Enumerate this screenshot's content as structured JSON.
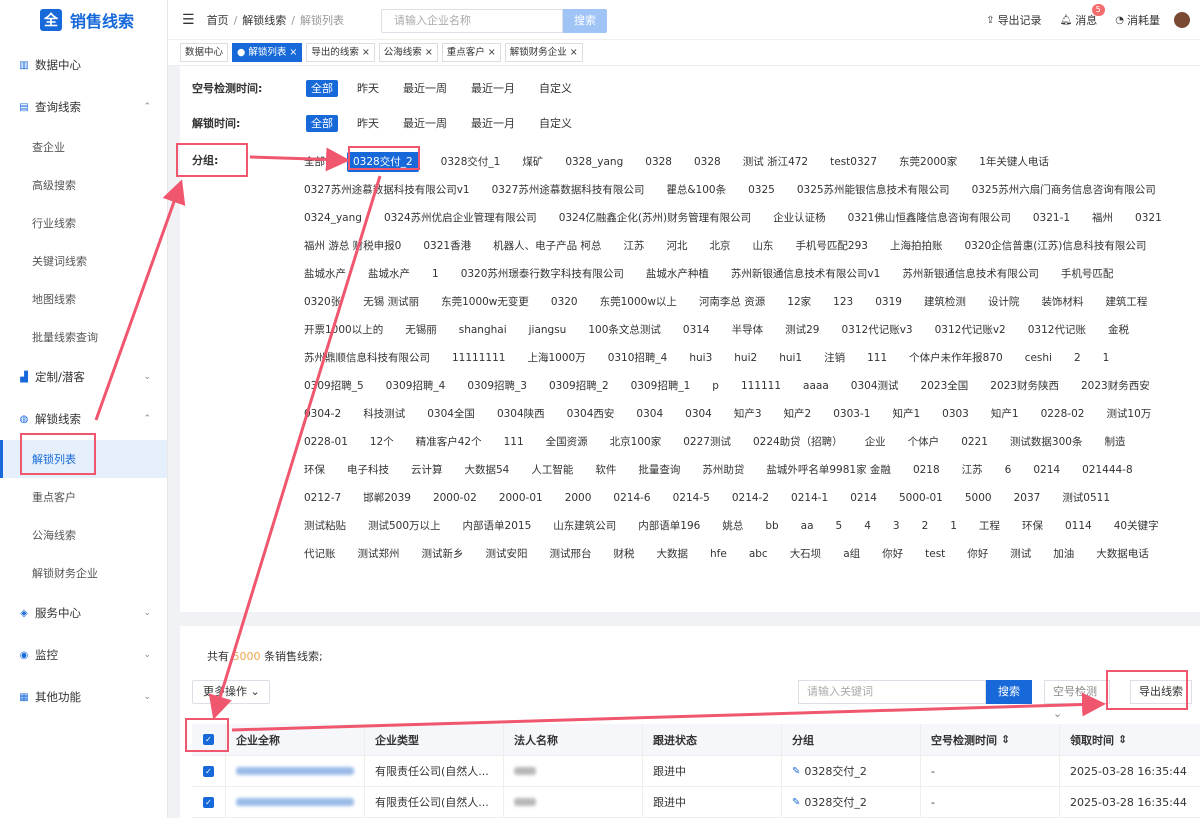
{
  "app": {
    "logo_char": "全",
    "title": "销售线索"
  },
  "sidebar": {
    "items": [
      {
        "type": "group",
        "label": "数据中心",
        "icon": "database-icon",
        "chev": ""
      },
      {
        "type": "group",
        "label": "查询线索",
        "icon": "query-icon",
        "chev": "⌃"
      },
      {
        "type": "sub",
        "label": "查企业"
      },
      {
        "type": "sub",
        "label": "高级搜索"
      },
      {
        "type": "sub",
        "label": "行业线索"
      },
      {
        "type": "sub",
        "label": "关键词线索"
      },
      {
        "type": "sub",
        "label": "地图线索"
      },
      {
        "type": "sub",
        "label": "批量线索查询"
      },
      {
        "type": "group",
        "label": "定制/潜客",
        "icon": "chart-icon",
        "chev": "⌄"
      },
      {
        "type": "group",
        "label": "解锁线索",
        "icon": "globe-icon",
        "chev": "⌃"
      },
      {
        "type": "sub",
        "label": "解锁列表",
        "active": true
      },
      {
        "type": "sub",
        "label": "重点客户"
      },
      {
        "type": "sub",
        "label": "公海线索"
      },
      {
        "type": "sub",
        "label": "解锁财务企业"
      },
      {
        "type": "group",
        "label": "服务中心",
        "icon": "cube-icon",
        "chev": "⌄"
      },
      {
        "type": "group",
        "label": "监控",
        "icon": "monitor-icon",
        "chev": "⌄"
      },
      {
        "type": "group",
        "label": "其他功能",
        "icon": "grid-icon",
        "chev": "⌄"
      }
    ]
  },
  "header": {
    "breadcrumb": [
      "首页",
      "解锁线索",
      "解锁列表"
    ],
    "search_placeholder": "请输入企业名称",
    "search_button": "搜索",
    "export_record": "导出记录",
    "message": "消息",
    "message_count": "5",
    "consumption": "消耗量"
  },
  "tabs": [
    {
      "label": "数据中心",
      "active": false,
      "closable": false
    },
    {
      "label": "解锁列表",
      "active": true,
      "closable": true
    },
    {
      "label": "导出的线索",
      "active": false,
      "closable": true
    },
    {
      "label": "公海线索",
      "active": false,
      "closable": true
    },
    {
      "label": "重点客户",
      "active": false,
      "closable": true
    },
    {
      "label": "解锁财务企业",
      "active": false,
      "closable": true
    }
  ],
  "filters": {
    "empty_check": {
      "label": "空号检测时间:",
      "options": [
        "全部",
        "昨天",
        "最近一周",
        "最近一月",
        "自定义"
      ],
      "selected": 0
    },
    "unlock_time": {
      "label": "解锁时间:",
      "options": [
        "全部",
        "昨天",
        "最近一周",
        "最近一月",
        "自定义"
      ],
      "selected": 0
    },
    "group": {
      "label": "分组:",
      "selected": 1,
      "tags": [
        "全部",
        "0328交付_2",
        "0328交付_1",
        "煤矿",
        "0328_yang",
        "0328",
        "0328",
        "测试 浙江472",
        "test0327",
        "东莞2000家",
        "1年关键人电话",
        "0327苏州途慕数据科技有限公司v1",
        "0327苏州途慕数据科技有限公司",
        "瞿总&100条",
        "0325",
        "0325苏州能银信息技术有限公司",
        "0325苏州六扇门商务信息咨询有限公司",
        "0324_yang",
        "0324苏州优启企业管理有限公司",
        "0324亿融鑫企化(苏州)财务管理有限公司",
        "企业认证杨",
        "0321佛山恒鑫隆信息咨询有限公司",
        "0321-1",
        "福州",
        "0321",
        "福州 游总 财税申报0",
        "0321香港",
        "机器人、电子产品 柯总",
        "江苏",
        "河北",
        "北京",
        "山东",
        "手机号匹配293",
        "上海拍拍账",
        "0320企信普惠(江苏)信息科技有限公司",
        "盐城水产",
        "盐城水产",
        "1",
        "0320苏州璟泰行数字科技有限公司",
        "盐城水产种植",
        "苏州新银通信息技术有限公司v1",
        "苏州新银通信息技术有限公司",
        "手机号匹配",
        "0320张",
        "无锡 测试丽",
        "东莞1000w无变更",
        "0320",
        "东莞1000w以上",
        "河南李总 资源",
        "12家",
        "123",
        "0319",
        "建筑检测",
        "设计院",
        "装饰材料",
        "建筑工程",
        "开票1000以上的",
        "无锡丽",
        "shanghai",
        "jiangsu",
        "100条文总测试",
        "0314",
        "半导体",
        "测试29",
        "0312代记账v3",
        "0312代记账v2",
        "0312代记账",
        "金税",
        "苏州鼎顺信息科技有限公司",
        "11111111",
        "上海1000万",
        "0310招聘_4",
        "hui3",
        "hui2",
        "hui1",
        "注销",
        "111",
        "个体户未作年报870",
        "ceshi",
        "2",
        "1",
        "0309招聘_5",
        "0309招聘_4",
        "0309招聘_3",
        "0309招聘_2",
        "0309招聘_1",
        "p",
        "111111",
        "aaaa",
        "0304测试",
        "2023全国",
        "2023财务陕西",
        "2023财务西安",
        "0304-2",
        "科技测试",
        "0304全国",
        "0304陕西",
        "0304西安",
        "0304",
        "0304",
        "知产3",
        "知产2",
        "0303-1",
        "知产1",
        "0303",
        "知产1",
        "0228-02",
        "测试10万",
        "0228-01",
        "12个",
        "精准客户42个",
        "111",
        "全国资源",
        "北京100家",
        "0227测试",
        "0224助贷（招聘）",
        "企业",
        "个体户",
        "0221",
        "测试数据300条",
        "制造",
        "环保",
        "电子科技",
        "云计算",
        "大数据54",
        "人工智能",
        "软件",
        "批量查询",
        "苏州助贷",
        "盐城外呼名单9981家 金融",
        "0218",
        "江苏",
        "6",
        "0214",
        "021444-8",
        "0212-7",
        "邯郸2039",
        "2000-02",
        "2000-01",
        "2000",
        "0214-6",
        "0214-5",
        "0214-2",
        "0214-1",
        "0214",
        "5000-01",
        "5000",
        "2037",
        "测试0511",
        "测试粘贴",
        "测试500万以上",
        "内部语单2015",
        "山东建筑公司",
        "内部语单196",
        "姚总",
        "bb",
        "aa",
        "5",
        "4",
        "3",
        "2",
        "1",
        "工程",
        "环保",
        "0114",
        "40关键字",
        "代记账",
        "测试郑州",
        "测试新乡",
        "测试安阳",
        "测试邢台",
        "财税",
        "大数据",
        "hfe",
        "abc",
        "大石坝",
        "a组",
        "你好",
        "test",
        "你好",
        "测试",
        "加油",
        "大数据电话"
      ]
    }
  },
  "list": {
    "total_prefix": "共有",
    "total_num": "5000",
    "total_suffix": "条销售线索;",
    "more_actions": "更多操作",
    "keyword_placeholder": "请输入关键词",
    "search_button": "搜索",
    "empty_check_select": "空号检测",
    "export_button": "导出线索",
    "columns": [
      "企业全称",
      "企业类型",
      "法人名称",
      "跟进状态",
      "分组",
      "空号检测时间",
      "领取时间"
    ],
    "rows": [
      {
        "type": "有限责任公司(自然人...",
        "status": "跟进中",
        "group": "0328交付_2",
        "check_time": "-",
        "time": "2025-03-28 16:35:44"
      },
      {
        "type": "有限责任公司(自然人...",
        "status": "跟进中",
        "group": "0328交付_2",
        "check_time": "-",
        "time": "2025-03-28 16:35:44"
      }
    ]
  }
}
